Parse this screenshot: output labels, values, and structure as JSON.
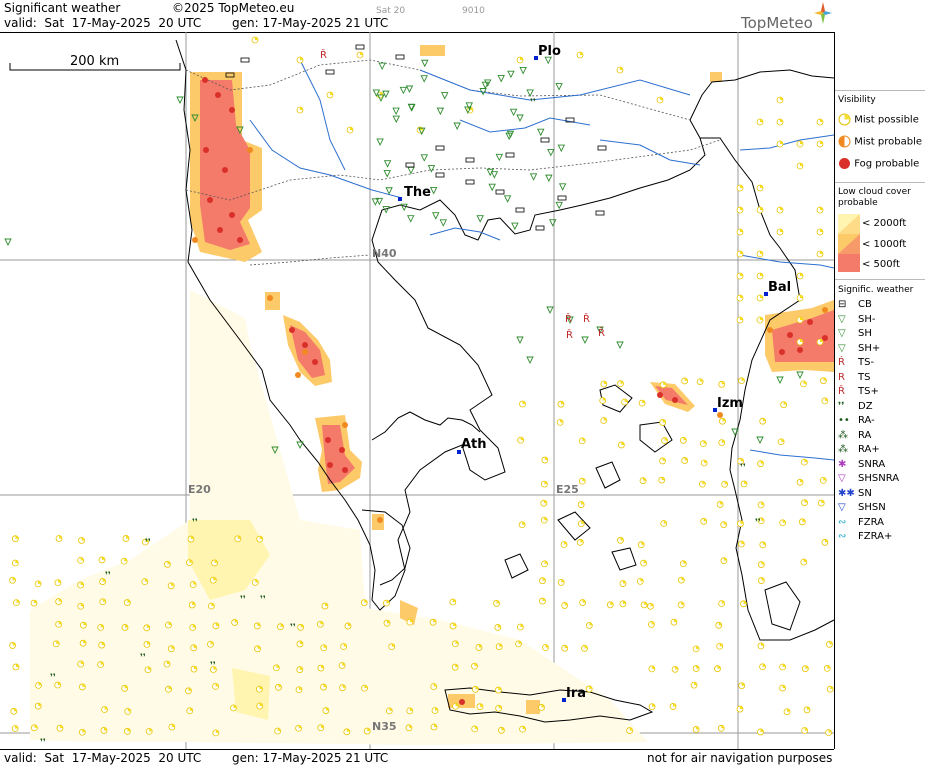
{
  "header": {
    "title": "Significant weather",
    "copyright": "©2025 TopMeteo.eu",
    "valid_label": "valid:  Sat  17-May-2025  20 UTC",
    "gen_label": "gen: 17-May-2025 21 UTC",
    "faint_day": "Sat 20",
    "faint_code": "9010",
    "logo": "TopMeteo"
  },
  "map": {
    "scale_label": "200 km",
    "grid_labels": {
      "n40": "N40",
      "n35": "N35",
      "e20": "E20",
      "e25": "E25"
    },
    "cities": [
      {
        "name": "Plo"
      },
      {
        "name": "The"
      },
      {
        "name": "Bal"
      },
      {
        "name": "Izm"
      },
      {
        "name": "Ath"
      },
      {
        "name": "Ira"
      }
    ]
  },
  "footer": {
    "valid_label": "valid:  Sat  17-May-2025  20 UTC",
    "gen_label": "gen: 17-May-2025 21 UTC",
    "disclaimer": "not for air navigation purposes"
  },
  "legend": {
    "visibility_title": "Visibility",
    "visibility": [
      {
        "label": "Mist possible",
        "icon": "mist-possible-icon"
      },
      {
        "label": "Mist probable",
        "icon": "mist-probable-icon"
      },
      {
        "label": "Fog probable",
        "icon": "fog-probable-icon"
      }
    ],
    "cloud_title_1": "Low cloud cover",
    "cloud_title_2": "probable",
    "cloud": [
      {
        "label": "< 2000ft",
        "color": "#fff5b0"
      },
      {
        "label": "< 1000ft",
        "color": "#fdca6a"
      },
      {
        "label": "<  500ft",
        "color": "#f47a6a"
      }
    ],
    "sigwx_title": "Signific. weather",
    "sigwx": [
      {
        "label": "CB",
        "icon": "cb-icon"
      },
      {
        "label": "SH-",
        "icon": "shower-light-icon"
      },
      {
        "label": "SH",
        "icon": "shower-icon"
      },
      {
        "label": "SH+",
        "icon": "shower-heavy-icon"
      },
      {
        "label": "TS-",
        "icon": "thunderstorm-light-icon"
      },
      {
        "label": "TS",
        "icon": "thunderstorm-icon"
      },
      {
        "label": "TS+",
        "icon": "thunderstorm-heavy-icon"
      },
      {
        "label": "DZ",
        "icon": "drizzle-icon"
      },
      {
        "label": "RA-",
        "icon": "rain-light-icon"
      },
      {
        "label": "RA",
        "icon": "rain-icon"
      },
      {
        "label": "RA+",
        "icon": "rain-heavy-icon"
      },
      {
        "label": "SNRA",
        "icon": "snow-rain-icon"
      },
      {
        "label": "SHSNRA",
        "icon": "snow-rain-shower-icon"
      },
      {
        "label": "SN",
        "icon": "snow-icon"
      },
      {
        "label": "SHSN",
        "icon": "snow-shower-icon"
      },
      {
        "label": "FZRA",
        "icon": "freezing-rain-icon"
      },
      {
        "label": "FZRA+",
        "icon": "freezing-rain-heavy-icon"
      }
    ]
  }
}
